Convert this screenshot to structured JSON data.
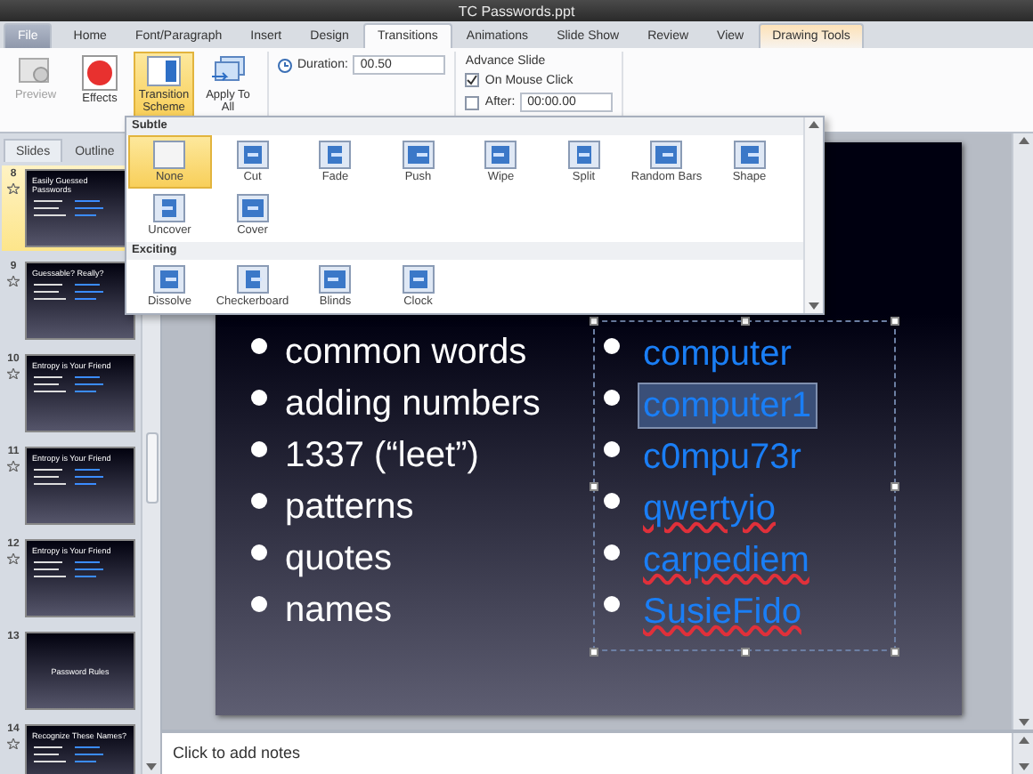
{
  "window": {
    "title": "TC Passwords.ppt"
  },
  "ribbon_tabs": [
    {
      "label": "File",
      "kind": "file",
      "selected": false
    },
    {
      "label": "Home",
      "kind": "normal",
      "selected": false
    },
    {
      "label": "Font/Paragraph",
      "kind": "normal",
      "selected": false
    },
    {
      "label": "Insert",
      "kind": "normal",
      "selected": false
    },
    {
      "label": "Design",
      "kind": "normal",
      "selected": false
    },
    {
      "label": "Transitions",
      "kind": "normal",
      "selected": true
    },
    {
      "label": "Animations",
      "kind": "normal",
      "selected": false
    },
    {
      "label": "Slide Show",
      "kind": "normal",
      "selected": false
    },
    {
      "label": "Review",
      "kind": "normal",
      "selected": false
    },
    {
      "label": "View",
      "kind": "normal",
      "selected": false
    },
    {
      "label": "Drawing Tools",
      "kind": "context",
      "selected": false
    }
  ],
  "ribbon": {
    "buttons": [
      {
        "label": "Preview",
        "kind": "preview",
        "disabled": true,
        "selected": false
      },
      {
        "label": "Effects",
        "kind": "effects",
        "disabled": false,
        "selected": false
      },
      {
        "label": "Transition Scheme",
        "kind": "scheme",
        "disabled": false,
        "selected": true
      },
      {
        "label": "Apply To All",
        "kind": "apply",
        "disabled": false,
        "selected": false
      }
    ],
    "duration": {
      "label": "Duration:",
      "value": "00.50"
    },
    "advance_slide": {
      "title": "Advance Slide",
      "on_mouse_click": {
        "label": "On Mouse Click",
        "checked": true
      },
      "after": {
        "label": "After:",
        "checked": false,
        "value": "00:00.00"
      }
    }
  },
  "gallery": {
    "sections": [
      {
        "title": "Subtle",
        "items": [
          {
            "label": "None",
            "selected": true
          },
          {
            "label": "Cut",
            "selected": false
          },
          {
            "label": "Fade",
            "selected": false
          },
          {
            "label": "Push",
            "selected": false
          },
          {
            "label": "Wipe",
            "selected": false
          },
          {
            "label": "Split",
            "selected": false
          },
          {
            "label": "Random Bars",
            "selected": false
          },
          {
            "label": "Shape",
            "selected": false
          },
          {
            "label": "Uncover",
            "selected": false
          },
          {
            "label": "Cover",
            "selected": false
          }
        ]
      },
      {
        "title": "Exciting",
        "items": [
          {
            "label": "Dissolve",
            "selected": false
          },
          {
            "label": "Checkerboard",
            "selected": false
          },
          {
            "label": "Blinds",
            "selected": false
          },
          {
            "label": "Clock",
            "selected": false
          }
        ]
      }
    ]
  },
  "side_panel": {
    "tabs": [
      {
        "label": "Slides",
        "selected": true
      },
      {
        "label": "Outline",
        "selected": false
      }
    ],
    "thumbnails": [
      {
        "number": "8",
        "title": "Easily Guessed Passwords",
        "selected": true,
        "has_transition": true,
        "kind": "list"
      },
      {
        "number": "9",
        "title": "Guessable? Really?",
        "selected": false,
        "has_transition": true,
        "kind": "list"
      },
      {
        "number": "10",
        "title": "Entropy is Your Friend",
        "selected": false,
        "has_transition": true,
        "kind": "list"
      },
      {
        "number": "11",
        "title": "Entropy is Your Friend",
        "selected": false,
        "has_transition": true,
        "kind": "list"
      },
      {
        "number": "12",
        "title": "Entropy is Your Friend",
        "selected": false,
        "has_transition": true,
        "kind": "list"
      },
      {
        "number": "13",
        "title": "Password Rules",
        "selected": false,
        "has_transition": false,
        "kind": "section"
      },
      {
        "number": "14",
        "title": "Recognize These Names?",
        "selected": false,
        "has_transition": true,
        "kind": "list"
      }
    ]
  },
  "slide": {
    "left_bullets": [
      "common words",
      "adding numbers",
      "1337 (“leet”)",
      "patterns",
      "quotes",
      "names"
    ],
    "right_bullets": [
      {
        "text": "computer",
        "highlighted": false,
        "misspelled": false
      },
      {
        "text": "computer1",
        "highlighted": true,
        "misspelled": false
      },
      {
        "text": "c0mpu73r",
        "highlighted": false,
        "misspelled": false
      },
      {
        "text": "qwertyio",
        "highlighted": false,
        "misspelled": true
      },
      {
        "text": "carpediem",
        "highlighted": false,
        "misspelled": true
      },
      {
        "text": "SusieFido",
        "highlighted": false,
        "misspelled": true
      }
    ]
  },
  "notes": {
    "placeholder": "Click to add notes"
  }
}
